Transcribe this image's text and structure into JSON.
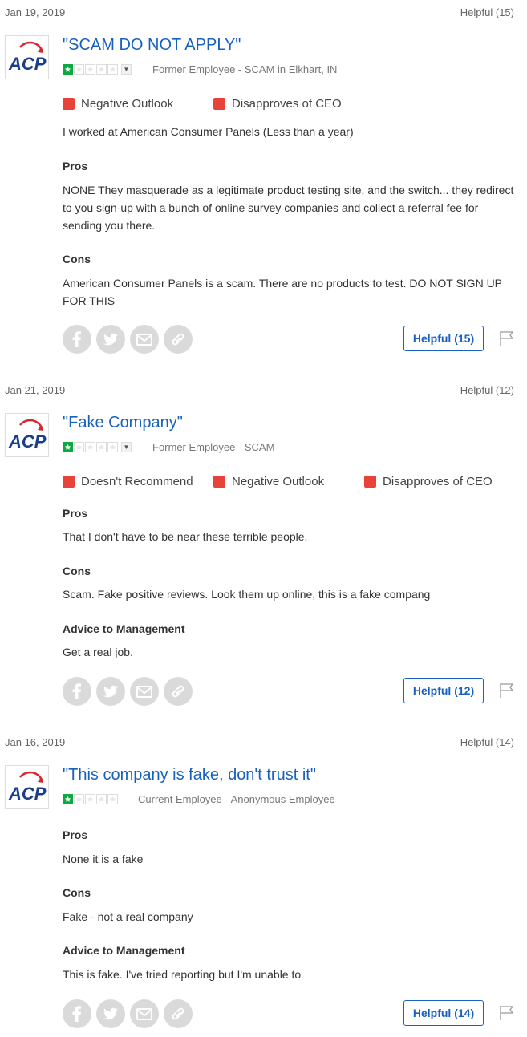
{
  "reviews": [
    {
      "date": "Jan 19, 2019",
      "helpful_count_label": "Helpful (15)",
      "company_logo_text": "ACP",
      "title": "\"SCAM DO NOT APPLY\"",
      "rating": 1,
      "max_rating": 5,
      "author": "Former Employee - SCAM in Elkhart, IN",
      "flags": [
        "Negative Outlook",
        "Disapproves of CEO"
      ],
      "intro": "I worked at American Consumer Panels (Less than a year)",
      "pros_label": "Pros",
      "pros": "NONE They masquerade as a legitimate product testing site, and the switch... they redirect to you sign-up with a bunch of online survey companies and collect a referral fee for sending you there.",
      "cons_label": "Cons",
      "cons": "American Consumer Panels is a scam. There are no products to test. DO NOT SIGN UP FOR THIS",
      "helpful_button": "Helpful (15)"
    },
    {
      "date": "Jan 21, 2019",
      "helpful_count_label": "Helpful (12)",
      "company_logo_text": "ACP",
      "title": "\"Fake Company\"",
      "rating": 1,
      "max_rating": 5,
      "author": "Former Employee - SCAM",
      "flags": [
        "Doesn't Recommend",
        "Negative Outlook",
        "Disapproves of CEO"
      ],
      "pros_label": "Pros",
      "pros": "That I don't have to be near these terrible people.",
      "cons_label": "Cons",
      "cons": "Scam. Fake positive reviews. Look them up online, this is a fake compang",
      "advice_label": "Advice to Management",
      "advice": "Get a real job.",
      "helpful_button": "Helpful (12)"
    },
    {
      "date": "Jan 16, 2019",
      "helpful_count_label": "Helpful (14)",
      "company_logo_text": "ACP",
      "title": "\"This company is fake, don't trust it\"",
      "rating": 1,
      "max_rating": 5,
      "author": "Current Employee - Anonymous Employee",
      "pros_label": "Pros",
      "pros": "None it is a fake",
      "cons_label": "Cons",
      "cons": "Fake - not a real company",
      "advice_label": "Advice to Management",
      "advice": "This is fake. I've tried reporting but I'm unable to",
      "helpful_button": "Helpful (14)"
    }
  ],
  "colors": {
    "link_blue": "#1861bf",
    "flag_red": "#e8433b",
    "star_green": "#0caa41",
    "icon_grey": "#dadada"
  },
  "icons": [
    "facebook-icon",
    "twitter-icon",
    "email-icon",
    "link-icon",
    "flag-icon",
    "star-icon",
    "chevron-down-icon"
  ]
}
